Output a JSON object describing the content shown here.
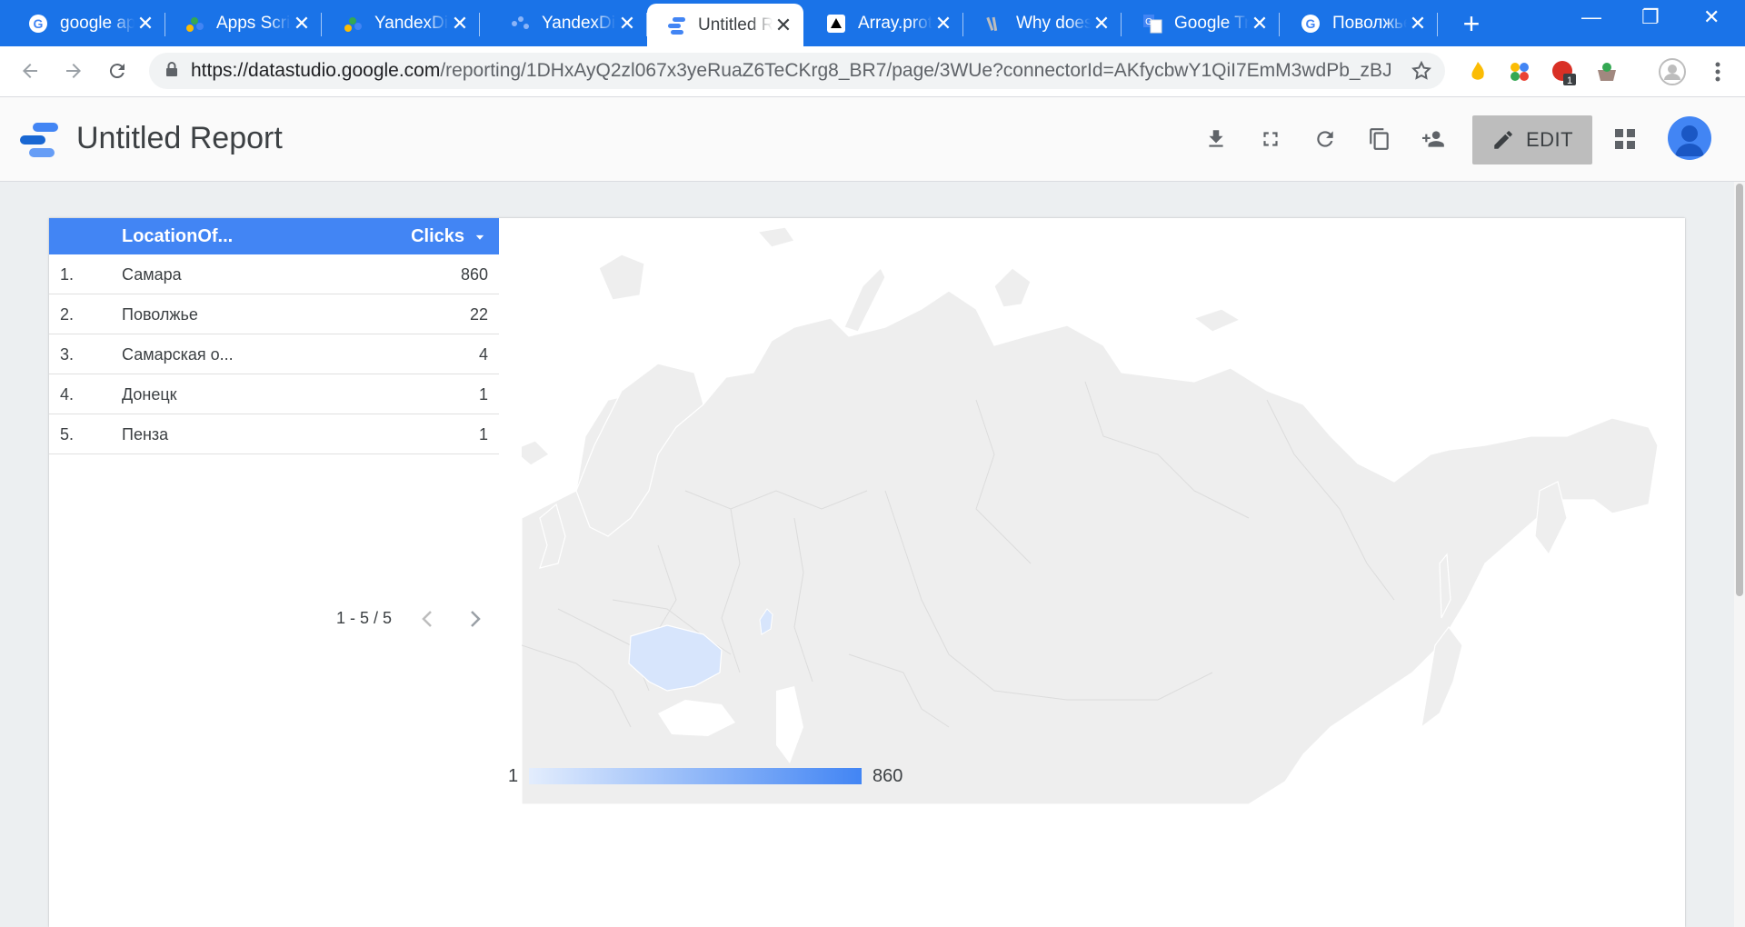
{
  "browser": {
    "tabs": [
      {
        "title": "google ap"
      },
      {
        "title": "Apps Scrip"
      },
      {
        "title": "YandexDir"
      },
      {
        "title": "YandexDir"
      },
      {
        "title": "Untitled R"
      },
      {
        "title": "Array.prot"
      },
      {
        "title": "Why does"
      },
      {
        "title": "Google Tr"
      },
      {
        "title": "Поволжье"
      }
    ],
    "url_host": "https://datastudio.google.com",
    "url_path": "/reporting/1DHxAyQ2zl067x3yeRuaZ6TeCKrg8_BR7/page/3WUe?connectorId=AKfycbwY1QiI7EmM3wdPb_zBJ...",
    "extension_badge": "1"
  },
  "report": {
    "title": "Untitled Report",
    "edit_label": "EDIT"
  },
  "table": {
    "columns": [
      "LocationOf...",
      "Clicks"
    ],
    "rows": [
      {
        "n": "1.",
        "location": "Самара",
        "clicks": "860"
      },
      {
        "n": "2.",
        "location": "Поволжье",
        "clicks": "22"
      },
      {
        "n": "3.",
        "location": "Самарская о...",
        "clicks": "4"
      },
      {
        "n": "4.",
        "location": "Донецк",
        "clicks": "1"
      },
      {
        "n": "5.",
        "location": "Пенза",
        "clicks": "1"
      }
    ],
    "pagination": "1 - 5 / 5"
  },
  "map": {
    "legend_min": "1",
    "legend_max": "860",
    "color_low": "#dbe8fd",
    "color_high": "#4285f4",
    "base_color": "#eeeeee"
  }
}
